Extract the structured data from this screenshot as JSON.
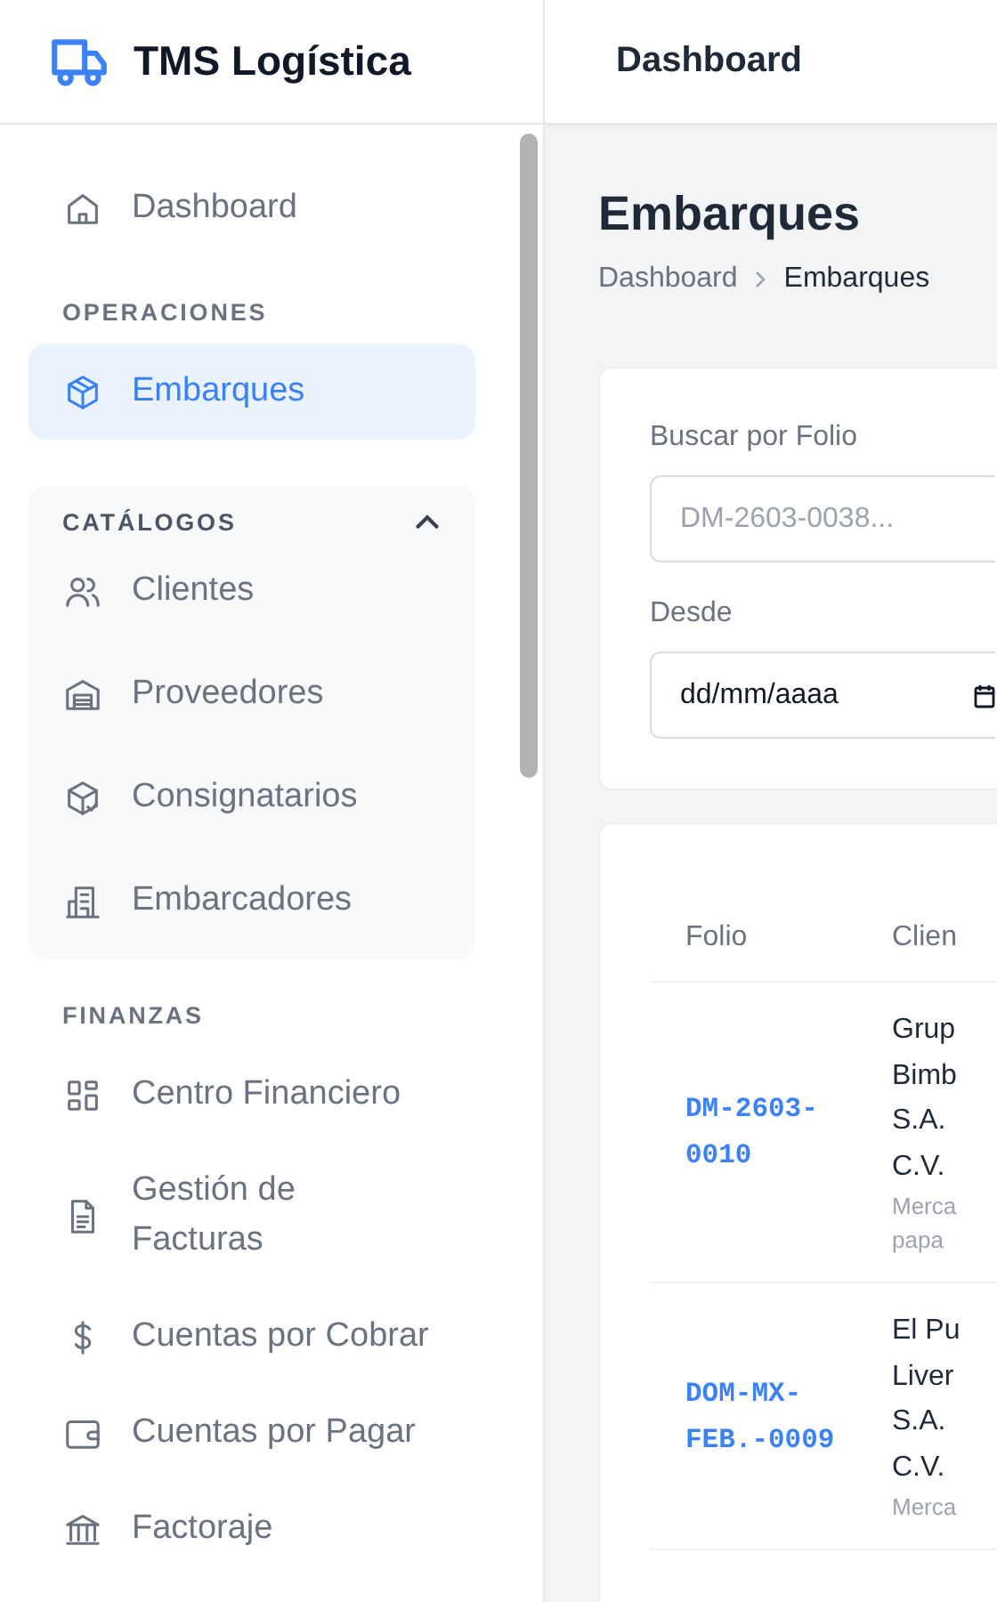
{
  "brand": {
    "name": "TMS Logística"
  },
  "header": {
    "title": "Dashboard"
  },
  "sidebar": {
    "items": [
      {
        "kind": "link",
        "label": "Dashboard",
        "selected": false
      },
      {
        "kind": "section",
        "label": "OPERACIONES"
      },
      {
        "kind": "link",
        "label": "Embarques",
        "selected": true
      },
      {
        "kind": "group",
        "label": "CATÁLOGOS",
        "expanded": true,
        "children": [
          {
            "label": "Clientes",
            "selected": false
          },
          {
            "label": "Proveedores",
            "selected": false
          },
          {
            "label": "Consignatarios",
            "selected": false
          },
          {
            "label": "Embarcadores",
            "selected": false
          }
        ]
      },
      {
        "kind": "section",
        "label": "FINANZAS"
      },
      {
        "kind": "link",
        "label": "Centro Financiero",
        "selected": false
      },
      {
        "kind": "link",
        "label": "Gestión de\nFacturas",
        "selected": false
      },
      {
        "kind": "link",
        "label": "Cuentas por Cobrar",
        "selected": false
      },
      {
        "kind": "link",
        "label": "Cuentas por Pagar",
        "selected": false
      },
      {
        "kind": "link",
        "label": "Factoraje",
        "selected": false
      }
    ]
  },
  "page": {
    "title": "Embarques",
    "breadcrumb": [
      "Dashboard",
      "Embarques"
    ]
  },
  "filters": [
    {
      "kind": "text",
      "label": "Buscar por Folio",
      "placeholder": "DM-2603-0038..."
    },
    {
      "kind": "date",
      "label": "Desde",
      "value": "dd/mm/aaaa"
    }
  ],
  "table": {
    "columns": [
      "Folio",
      "Clien"
    ],
    "rows": [
      {
        "folio": "DM-2603-0010",
        "client": "Grup\nBimb\nS.A.\nC.V.",
        "detail": "Merca\npapa"
      },
      {
        "folio": "DOM-MX-FEB.-0009",
        "client": "El Pu\nLiver\nS.A.\nC.V.",
        "detail": "Merca"
      }
    ]
  }
}
